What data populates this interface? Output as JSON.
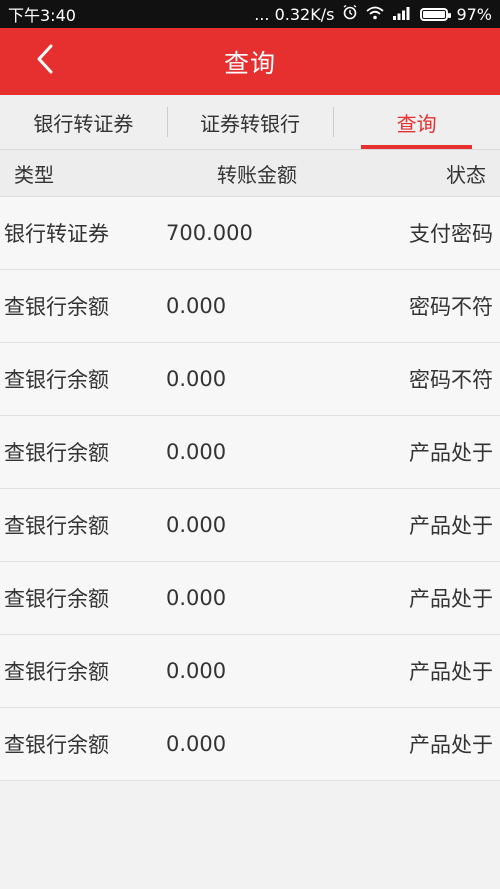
{
  "status_bar": {
    "time": "下午3:40",
    "network_speed": "... 0.32K/s",
    "battery_percent": "97%",
    "battery_level": 0.97
  },
  "header": {
    "back_icon": "chevron-left-icon",
    "title": "查询"
  },
  "tabs": [
    {
      "label": "银行转证券",
      "active": false
    },
    {
      "label": "证券转银行",
      "active": false
    },
    {
      "label": "查询",
      "active": true
    }
  ],
  "columns": {
    "type": "类型",
    "amount": "转账金额",
    "status": "状态"
  },
  "rows": [
    {
      "type": "银行转证券",
      "amount": "700.000",
      "status": "支付密码"
    },
    {
      "type": "查银行余额",
      "amount": "0.000",
      "status": "密码不符"
    },
    {
      "type": "查银行余额",
      "amount": "0.000",
      "status": "密码不符"
    },
    {
      "type": "查银行余额",
      "amount": "0.000",
      "status": "产品处于"
    },
    {
      "type": "查银行余额",
      "amount": "0.000",
      "status": "产品处于"
    },
    {
      "type": "查银行余额",
      "amount": "0.000",
      "status": "产品处于"
    },
    {
      "type": "查银行余额",
      "amount": "0.000",
      "status": "产品处于"
    },
    {
      "type": "查银行余额",
      "amount": "0.000",
      "status": "产品处于"
    }
  ],
  "colors": {
    "accent": "#e5302f",
    "status_bar": "#111111",
    "background": "#f2f2f2"
  }
}
